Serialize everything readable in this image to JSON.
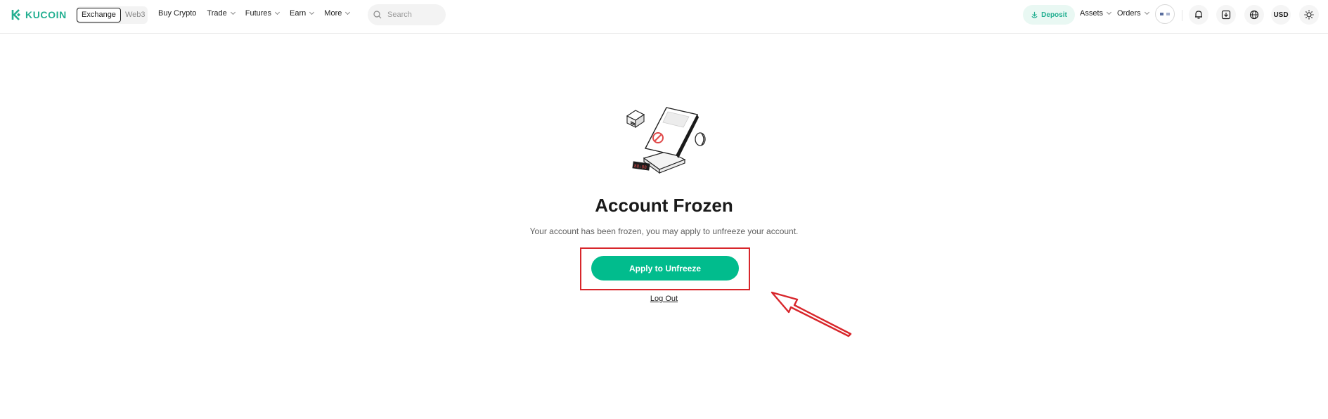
{
  "header": {
    "logo_text": "KUCOIN",
    "brand_color": "#23af91",
    "mode_tabs": [
      {
        "label": "Exchange",
        "active": true
      },
      {
        "label": "Web3",
        "active": false
      }
    ],
    "nav_items": [
      {
        "label": "Buy Crypto",
        "has_caret": false
      },
      {
        "label": "Trade",
        "has_caret": true
      },
      {
        "label": "Futures",
        "has_caret": true
      },
      {
        "label": "Earn",
        "has_caret": true
      },
      {
        "label": "More",
        "has_caret": true
      }
    ],
    "search": {
      "placeholder": "Search",
      "icon": "search-icon"
    },
    "deposit_label": "Deposit",
    "assets_label": "Assets",
    "orders_label": "Orders",
    "currency_label": "USD",
    "icons": [
      "avatar",
      "bell-icon",
      "download-icon",
      "globe-icon",
      "sun-icon"
    ]
  },
  "main": {
    "illustration": "frozen-account-illustration",
    "title": "Account Frozen",
    "subtitle": "Your account has been frozen, you may apply to unfreeze your account.",
    "apply_button": "Apply to Unfreeze",
    "logout_link": "Log Out",
    "button_color": "#01bc8d"
  },
  "annotation": {
    "highlight_color": "#d8262b",
    "arrow_target": "apply-to-unfreeze-button"
  }
}
